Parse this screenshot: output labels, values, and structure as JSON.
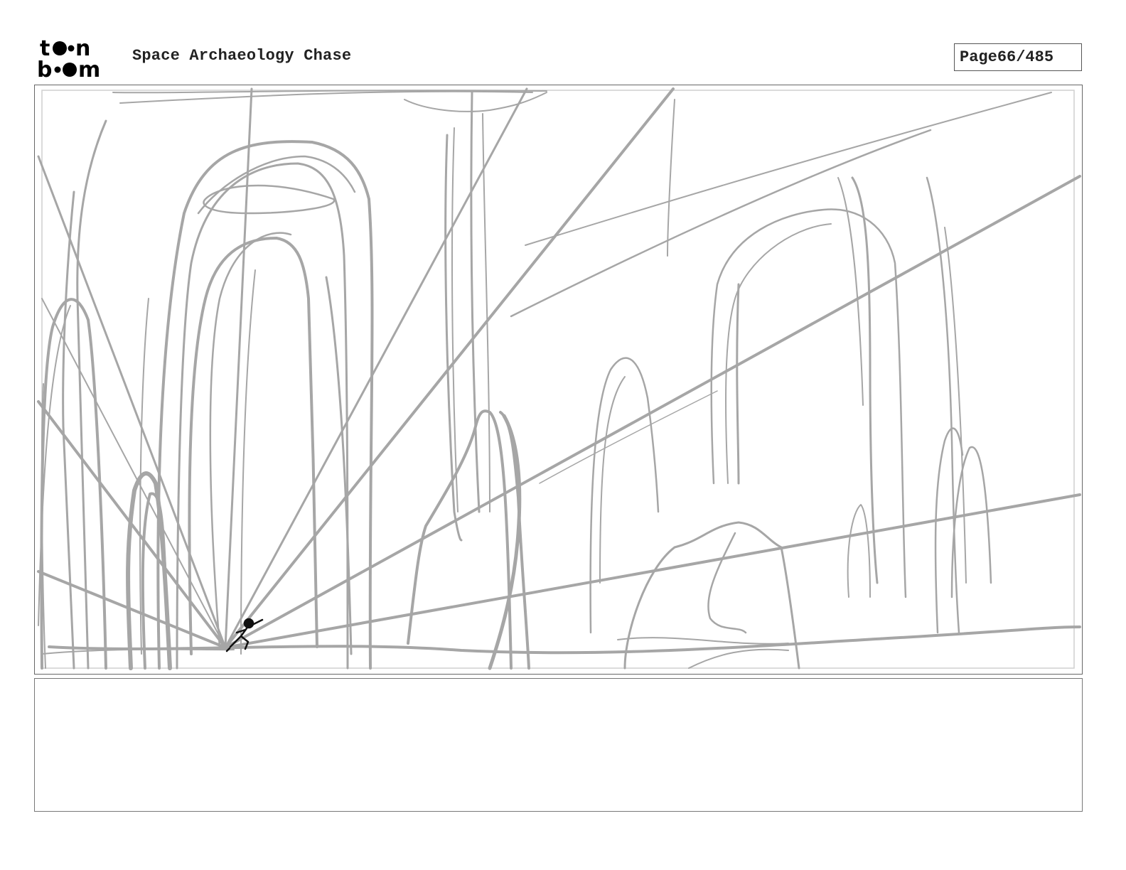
{
  "header": {
    "logo_text_top": "toon",
    "logo_text_bottom": "boom",
    "project_title": "Space Archaeology Chase",
    "page_label": "Page",
    "page_number": "66/485"
  },
  "panel": {
    "sketch_color": "#a6a6a6",
    "character_color": "#111111"
  },
  "notes": {
    "text": ""
  }
}
